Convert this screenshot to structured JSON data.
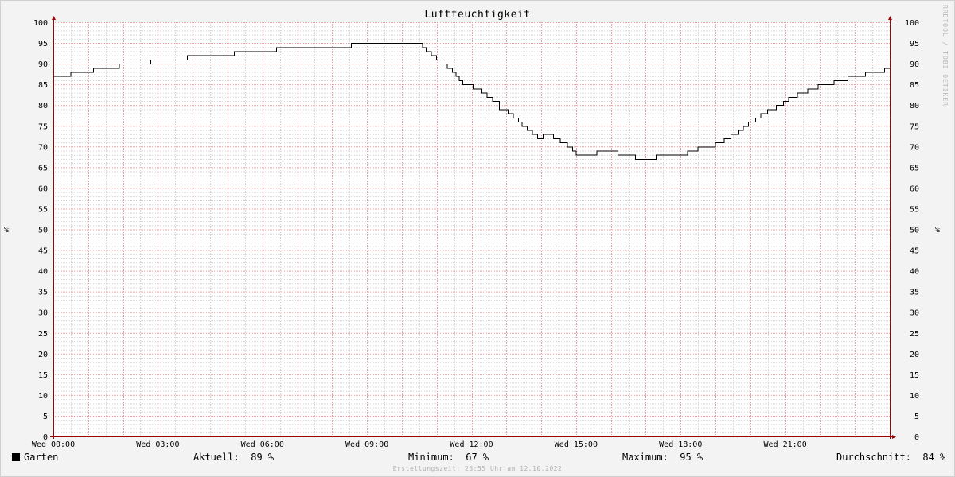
{
  "chart_data": {
    "type": "line",
    "title": "Luftfeuchtigkeit",
    "ylabel": "%",
    "ylim": [
      0,
      100
    ],
    "yticks": [
      0,
      5,
      10,
      15,
      20,
      25,
      30,
      35,
      40,
      45,
      50,
      55,
      60,
      65,
      70,
      75,
      80,
      85,
      90,
      95,
      100
    ],
    "xlim": [
      0,
      24
    ],
    "xtick_labels": [
      "Wed 00:00",
      "Wed 03:00",
      "Wed 06:00",
      "Wed 09:00",
      "Wed 12:00",
      "Wed 15:00",
      "Wed 18:00",
      "Wed 21:00"
    ],
    "xtick_hours": [
      0,
      3,
      6,
      9,
      12,
      15,
      18,
      21
    ],
    "grid": true,
    "series": [
      {
        "name": "Garten",
        "color": "#000000",
        "x": [
          0.0,
          0.5,
          1.15,
          1.9,
          2.8,
          3.85,
          5.2,
          6.4,
          8.55,
          9.75,
          10.6,
          10.7,
          10.85,
          11.0,
          11.15,
          11.3,
          11.45,
          11.55,
          11.65,
          11.75,
          11.9,
          12.05,
          12.3,
          12.45,
          12.6,
          12.8,
          13.05,
          13.2,
          13.35,
          13.45,
          13.6,
          13.75,
          13.9,
          14.05,
          14.15,
          14.35,
          14.55,
          14.75,
          14.9,
          15.0,
          15.15,
          15.6,
          15.8,
          16.2,
          16.7,
          17.3,
          17.8,
          18.2,
          18.5,
          18.75,
          19.0,
          19.25,
          19.45,
          19.65,
          19.8,
          19.95,
          20.15,
          20.3,
          20.5,
          20.75,
          20.95,
          21.1,
          21.35,
          21.65,
          21.95,
          22.4,
          22.8,
          23.3,
          23.85
        ],
        "y": [
          87,
          88,
          89,
          90,
          91,
          92,
          93,
          94,
          95,
          95,
          94,
          93,
          92,
          91,
          90,
          89,
          88,
          87,
          86,
          85,
          85,
          84,
          83,
          82,
          81,
          79,
          78,
          77,
          76,
          75,
          74,
          73,
          72,
          73,
          73,
          72,
          71,
          70,
          69,
          68,
          68,
          69,
          69,
          68,
          67,
          68,
          68,
          69,
          70,
          70,
          71,
          72,
          73,
          74,
          75,
          76,
          77,
          78,
          79,
          80,
          81,
          82,
          83,
          84,
          85,
          86,
          87,
          88,
          89
        ]
      }
    ]
  },
  "watermark": "RRDTOOL / TOBI OETIKER",
  "legend": {
    "series_label": "Garten",
    "current": "Aktuell:  89 %",
    "minimum": "Minimum:  67 %",
    "maximum": "Maximum:  95 %",
    "average": "Durchschnitt:  84 %"
  },
  "footer": "Erstellungszeit: 23:55 Uhr am 12.10.2022",
  "colors": {
    "background": "#f3f3f3",
    "plot_background": "#ffffff",
    "major_grid": "#e8a0a0",
    "minor_grid": "#d6d6d6",
    "axis": "#a00000",
    "line": "#000000"
  }
}
